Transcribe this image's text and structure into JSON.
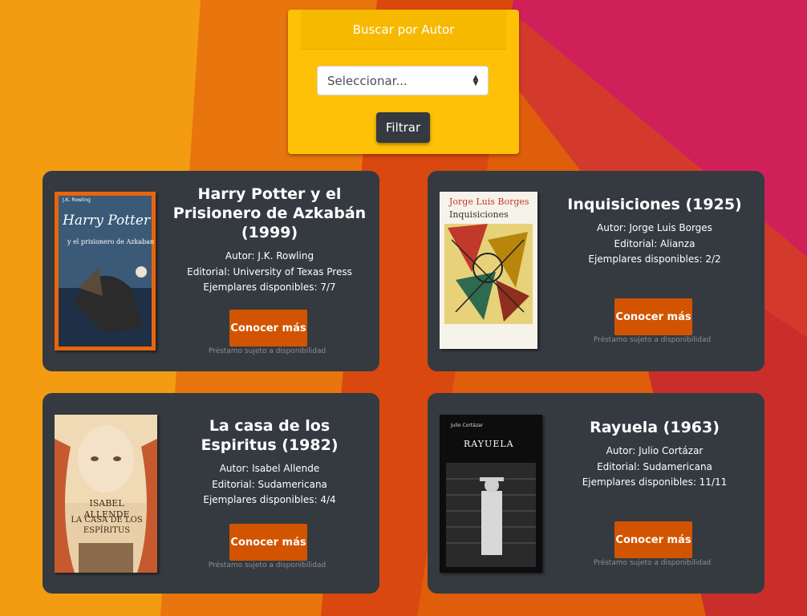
{
  "filter": {
    "header": "Buscar por Autor",
    "select_value": "Seleccionar...",
    "button_label": "Filtrar"
  },
  "books": [
    {
      "title": "Harry Potter y el Prisionero de Azkabán (1999)",
      "author_line": "Autor: J.K. Rowling",
      "publisher_line": "Editorial: University of Texas Press",
      "copies_line": "Ejemplares disponibles: 7/7",
      "button_label": "Conocer más",
      "note": "Préstamo sujeto a disponibilidad",
      "cover_author": "J.K. Rowling",
      "cover_title": "Harry Potter",
      "cover_subtitle": "y el prisionero de Azkaban"
    },
    {
      "title": "Inquisiciones (1925)",
      "author_line": "Autor: Jorge Luis Borges",
      "publisher_line": "Editorial: Alianza",
      "copies_line": "Ejemplares disponibles: 2/2",
      "button_label": "Conocer más",
      "note": "Préstamo sujeto a disponibilidad",
      "cover_author": "Jorge Luis Borges",
      "cover_title": "Inquisiciones"
    },
    {
      "title": "La casa de los Espiritus (1982)",
      "author_line": "Autor: Isabel Allende",
      "publisher_line": "Editorial: Sudamericana",
      "copies_line": "Ejemplares disponibles: 4/4",
      "button_label": "Conocer más",
      "note": "Préstamo sujeto a disponibilidad",
      "cover_author": "ISABEL ALLENDE",
      "cover_title": "LA CASA DE LOS ESPÍRITUS"
    },
    {
      "title": "Rayuela (1963)",
      "author_line": "Autor: Julio Cortázar",
      "publisher_line": "Editorial: Sudamericana",
      "copies_line": "Ejemplares disponibles: 11/11",
      "button_label": "Conocer más",
      "note": "Préstamo sujeto a disponibilidad",
      "cover_author": "Julio Cortázar",
      "cover_title": "RAYUELA"
    }
  ]
}
